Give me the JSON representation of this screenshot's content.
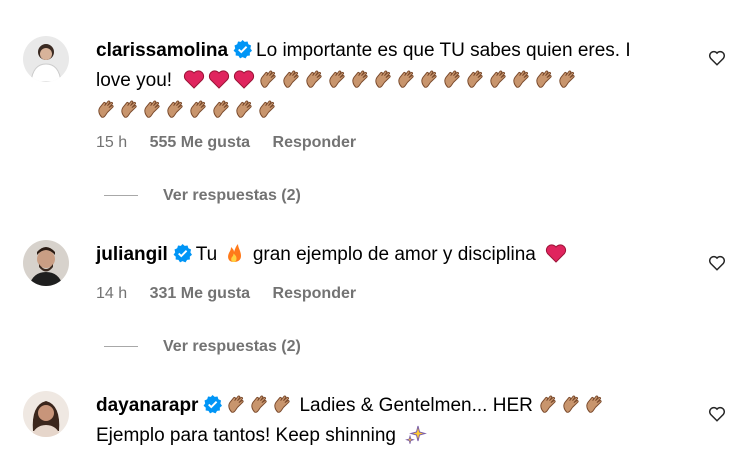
{
  "comments": [
    {
      "username": "clarissamolina",
      "text_part1": "Lo importante es que TU sabes quien eres. I",
      "text_part2": "love you!",
      "time": "15 h",
      "likes": "555 Me gusta",
      "reply": "Responder",
      "replies": "Ver respuestas (2)"
    },
    {
      "username": "juliangil",
      "text_part1": "Tu",
      "text_part2": "gran ejemplo de amor y disciplina",
      "time": "14 h",
      "likes": "331 Me gusta",
      "reply": "Responder",
      "replies": "Ver respuestas (2)"
    },
    {
      "username": "dayanarapr",
      "text_part1": "Ladies & Gentelmen... HER",
      "text_part2": "Ejemplo para tantos! Keep shinning"
    }
  ],
  "icons": {
    "verified": "verified-badge-icon",
    "like": "heart-outline-icon",
    "clap": "clapping-hands-icon",
    "heart": "red-heart-icon",
    "fire": "fire-icon",
    "sparkles": "sparkles-icon"
  },
  "colors": {
    "verified_blue": "#0095f6",
    "muted_text": "#737373",
    "heart_red": "#e0245e",
    "clap_skin": "#c8956d"
  }
}
